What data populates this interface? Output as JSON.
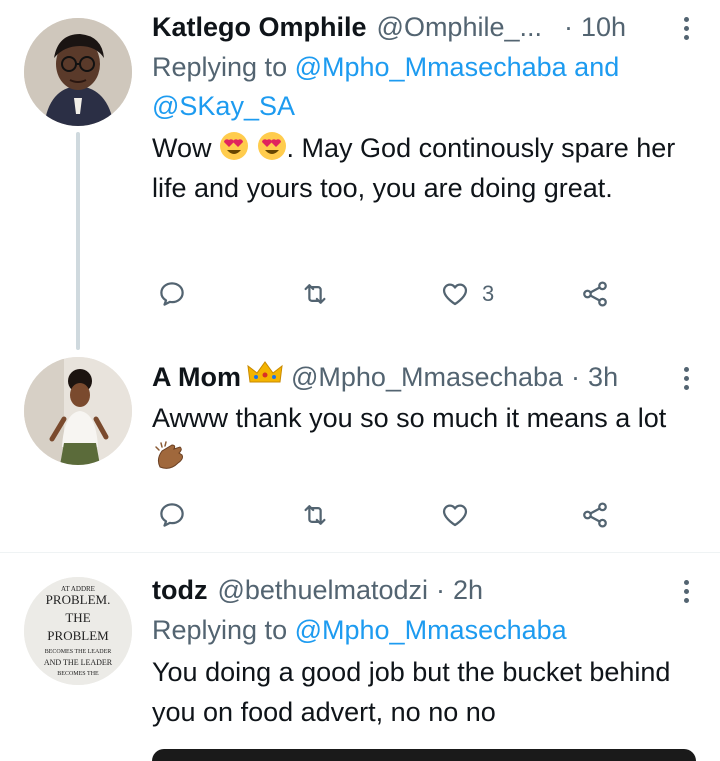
{
  "tweets": [
    {
      "name": "Katlego Omphile",
      "handle": "@Omphile_...",
      "separator": "·",
      "time": "10h",
      "replying_prefix": "Replying to",
      "replying_mention_1": "@Mpho_Mmasechaba",
      "replying_and": "and",
      "replying_mention_2": "@SKay_SA",
      "text_start": "Wow",
      "text_rest": ". May God continously spare her life and yours too, you are doing great.",
      "likes": "3"
    },
    {
      "name": "A Mom",
      "handle": "@Mpho_Mmasechaba",
      "separator": "·",
      "time": "3h",
      "text": "Awww thank you so so much it means a lot"
    },
    {
      "name": "todz",
      "handle": "@bethuelmatodzi",
      "separator": "·",
      "time": "2h",
      "replying_prefix": "Replying to",
      "replying_mention_1": "@Mpho_Mmasechaba",
      "text": "You doing a good job but the bucket behind you on food advert, no no no"
    }
  ],
  "avatar3_text": {
    "line1": "AT ADDRE",
    "line2": "PROBLEM.",
    "line3": "THE",
    "line4": "PROBLEM",
    "line5": "BECOMES THE LEADER",
    "line6": "AND THE LEADER",
    "line7": "BECOMES THE"
  },
  "icons": {
    "reply": "reply-icon",
    "retweet": "retweet-icon",
    "like": "heart-icon",
    "share": "share-icon",
    "more": "more-vertical-icon"
  },
  "colors": {
    "text": "#0f1419",
    "secondary": "#536471",
    "link": "#1d9bf0",
    "thread_line": "#cfd9de",
    "divider": "#eff3f4"
  }
}
